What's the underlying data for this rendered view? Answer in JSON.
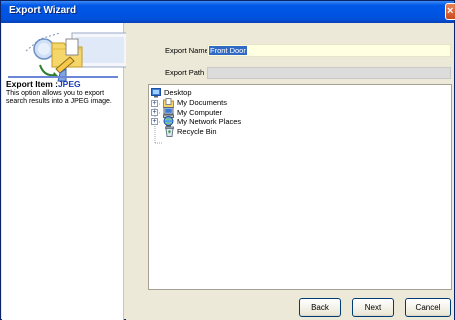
{
  "window": {
    "title": "Export Wizard",
    "close_symbol": "×"
  },
  "left": {
    "export_item_label": "Export Item :",
    "export_item_value": "JPEG",
    "description": "This option allows you to export search results into a JPEG image."
  },
  "form": {
    "export_name_label": "Export Name",
    "export_name_value": "Front Door",
    "export_path_label": "Export Path",
    "export_path_value": ""
  },
  "tree": {
    "items": [
      {
        "label": "Desktop",
        "icon": "desktop-icon"
      },
      {
        "label": "My Documents",
        "icon": "folder-documents-icon"
      },
      {
        "label": "My Computer",
        "icon": "computer-icon"
      },
      {
        "label": "My Network Places",
        "icon": "network-places-icon"
      },
      {
        "label": "Recycle Bin",
        "icon": "recycle-bin-icon"
      }
    ]
  },
  "buttons": {
    "back": "Back",
    "next": "Next",
    "cancel": "Cancel"
  },
  "colors": {
    "title_bar": "#0054e3",
    "accent_text": "#1a3dbe",
    "selection": "#316ac5",
    "name_field_bg": "#ffffe1"
  }
}
